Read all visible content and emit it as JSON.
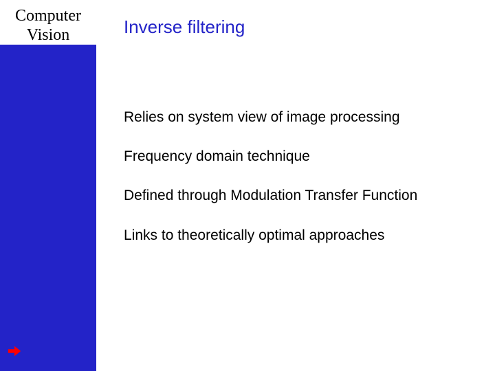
{
  "sidebar": {
    "title_line1": "Computer",
    "title_line2": "Vision"
  },
  "slide": {
    "heading": "Inverse filtering",
    "bullets": [
      "Relies on system view of image processing",
      "Frequency domain technique",
      "Defined through Modulation Transfer Function",
      "Links to theoretically optimal approaches"
    ]
  },
  "icons": {
    "arrow": "arrow-right"
  },
  "colors": {
    "sidebar_bg": "#2323c8",
    "heading": "#2323c8",
    "arrow": "#ff0000"
  }
}
